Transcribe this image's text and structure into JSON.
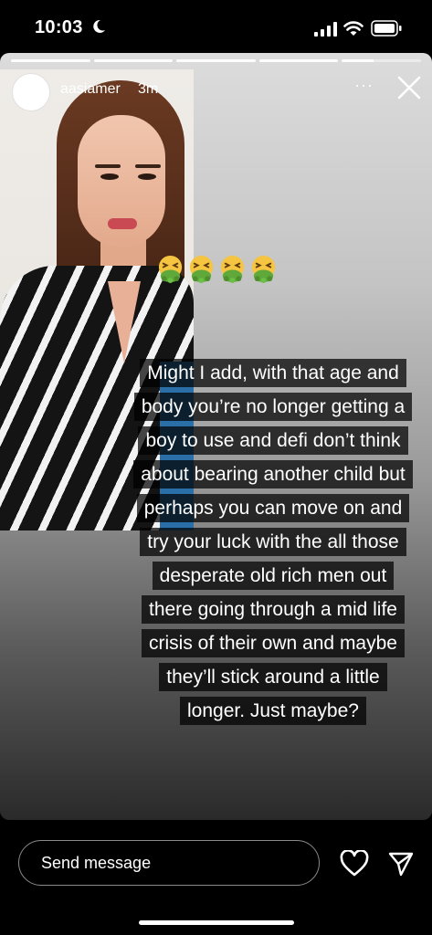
{
  "status_bar": {
    "time": "10:03"
  },
  "story": {
    "segments": [
      1,
      1,
      1,
      1,
      0.4
    ],
    "username": "aasiamer",
    "time_ago": "3m",
    "more": "···",
    "avatar_text": "",
    "emoji_count": 4,
    "caption_lines": [
      "Might I add, with that age and",
      "body you’re no longer getting a",
      "boy to use and defi don’t think",
      "about bearing another child but",
      "perhaps you can move on and",
      "try your luck with the all those",
      "desperate old rich  men out",
      "there going through a mid life",
      "crisis of their own and maybe",
      "they’ll stick around a little",
      "longer. Just maybe?"
    ]
  },
  "reply_bar": {
    "message_placeholder": "Send message"
  },
  "icons": {
    "moon": "moon-icon",
    "signal": "signal-icon",
    "wifi": "wifi-icon",
    "battery": "battery-icon",
    "close": "close-icon",
    "heart": "heart-icon",
    "send": "send-icon"
  }
}
